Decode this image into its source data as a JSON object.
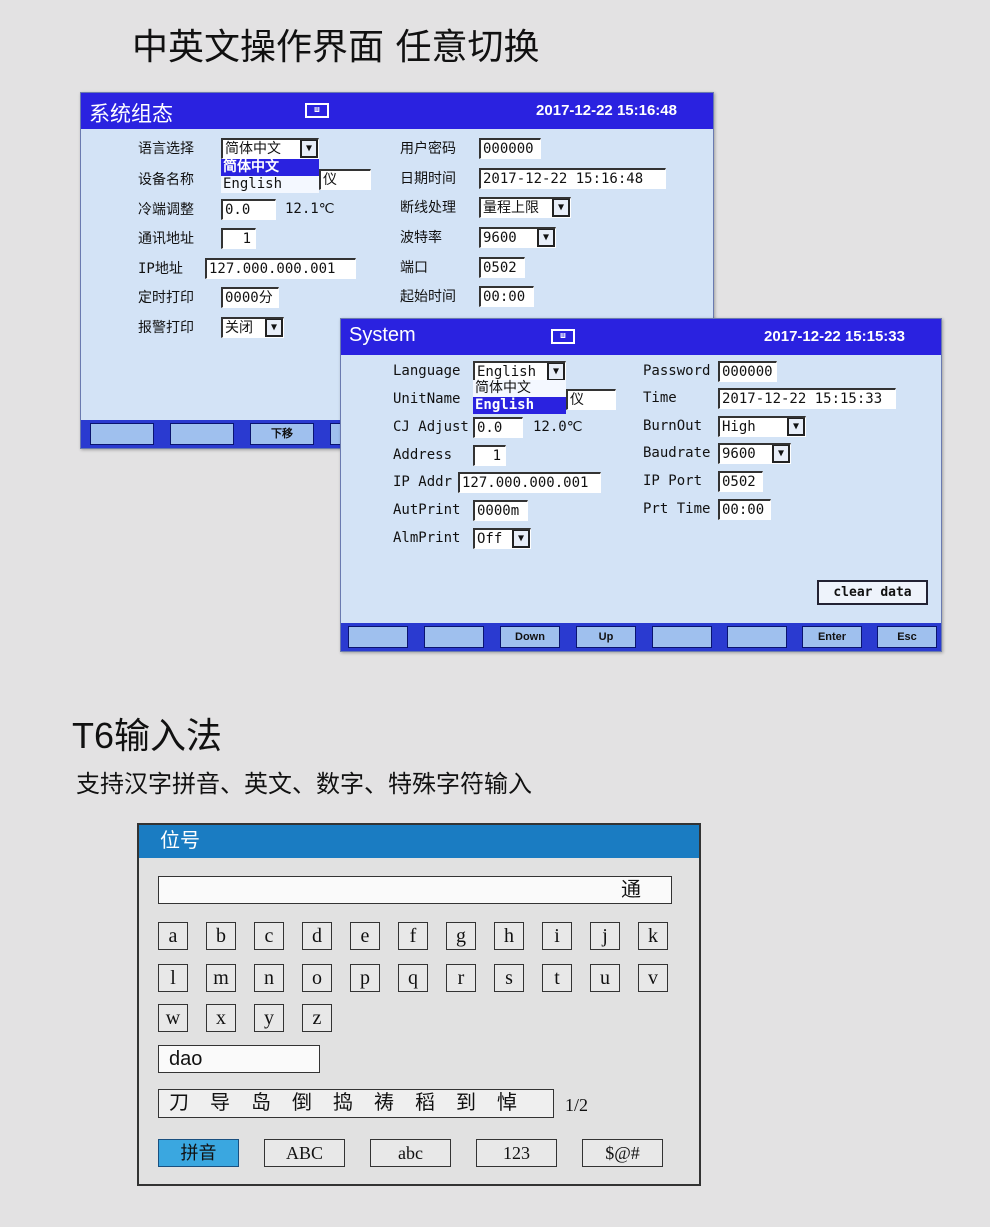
{
  "heading1": "中英文操作界面  任意切换",
  "heading2": "T6输入法",
  "subheading": "支持汉字拼音、英文、数字、特殊字符输入",
  "colors": {
    "header_blue": "#2a22e0",
    "panel_bg": "#d3e3f6",
    "kb_header": "#1a7cc2",
    "kb_selected": "#3aa7e0"
  },
  "cn_panel": {
    "title": "系统组态",
    "icon": "recorder-icon",
    "datetime": "2017-12-22 15:16:48",
    "left": [
      {
        "label": "语言选择",
        "value": "简体中文"
      },
      {
        "label": "设备名称",
        "value": "仪"
      },
      {
        "label": "冷端调整",
        "value": "0.0",
        "extra": "12.1℃"
      },
      {
        "label": "通讯地址",
        "value": "1"
      },
      {
        "label": "IP地址",
        "value": "127.000.000.001"
      },
      {
        "label": "定时打印",
        "value": "0000分"
      },
      {
        "label": "报警打印",
        "value": "关闭"
      }
    ],
    "dropdown": [
      "简体中文",
      "English"
    ],
    "right": [
      {
        "label": "用户密码",
        "value": "000000"
      },
      {
        "label": "日期时间",
        "value": "2017-12-22  15:16:48"
      },
      {
        "label": "断线处理",
        "value": "量程上限"
      },
      {
        "label": "波特率",
        "value": "9600"
      },
      {
        "label": "端口",
        "value": "0502"
      },
      {
        "label": "起始时间",
        "value": "00:00"
      }
    ],
    "buttons": [
      "",
      "",
      "下移",
      ""
    ]
  },
  "en_panel": {
    "title": "System",
    "icon": "recorder-icon",
    "datetime": "2017-12-22 15:15:33",
    "left": [
      {
        "label": "Language",
        "value": "English"
      },
      {
        "label": "UnitName",
        "value": "仪"
      },
      {
        "label": "CJ Adjust",
        "value": "0.0",
        "extra": "12.0℃"
      },
      {
        "label": "Address",
        "value": "1"
      },
      {
        "label": "IP Addr",
        "value": "127.000.000.001"
      },
      {
        "label": "AutPrint",
        "value": "0000m"
      },
      {
        "label": "AlmPrint",
        "value": "Off"
      }
    ],
    "dropdown": [
      "简体中文",
      "English"
    ],
    "right": [
      {
        "label": "Password",
        "value": "000000"
      },
      {
        "label": "Time",
        "value": "2017-12-22  15:15:33"
      },
      {
        "label": "BurnOut",
        "value": "High"
      },
      {
        "label": "Baudrate",
        "value": "9600"
      },
      {
        "label": "IP Port",
        "value": "0502"
      },
      {
        "label": "Prt Time",
        "value": "00:00"
      }
    ],
    "clear_data": "clear data",
    "buttons": [
      "",
      "",
      "Down",
      "Up",
      "",
      "",
      "Enter",
      "Esc"
    ]
  },
  "keyboard": {
    "title": "位号",
    "input_value": "通",
    "keys": [
      "a",
      "b",
      "c",
      "d",
      "e",
      "f",
      "g",
      "h",
      "i",
      "j",
      "k",
      "l",
      "m",
      "n",
      "o",
      "p",
      "q",
      "r",
      "s",
      "t",
      "u",
      "v",
      "w",
      "x",
      "y",
      "z"
    ],
    "pinyin": "dao",
    "candidates": [
      "刀",
      "导",
      "岛",
      "倒",
      "捣",
      "祷",
      "稻",
      "到",
      "悼"
    ],
    "page": "1/2",
    "modes": [
      "拼音",
      "ABC",
      "abc",
      "123",
      "$@#"
    ],
    "selected_mode": "拼音"
  }
}
